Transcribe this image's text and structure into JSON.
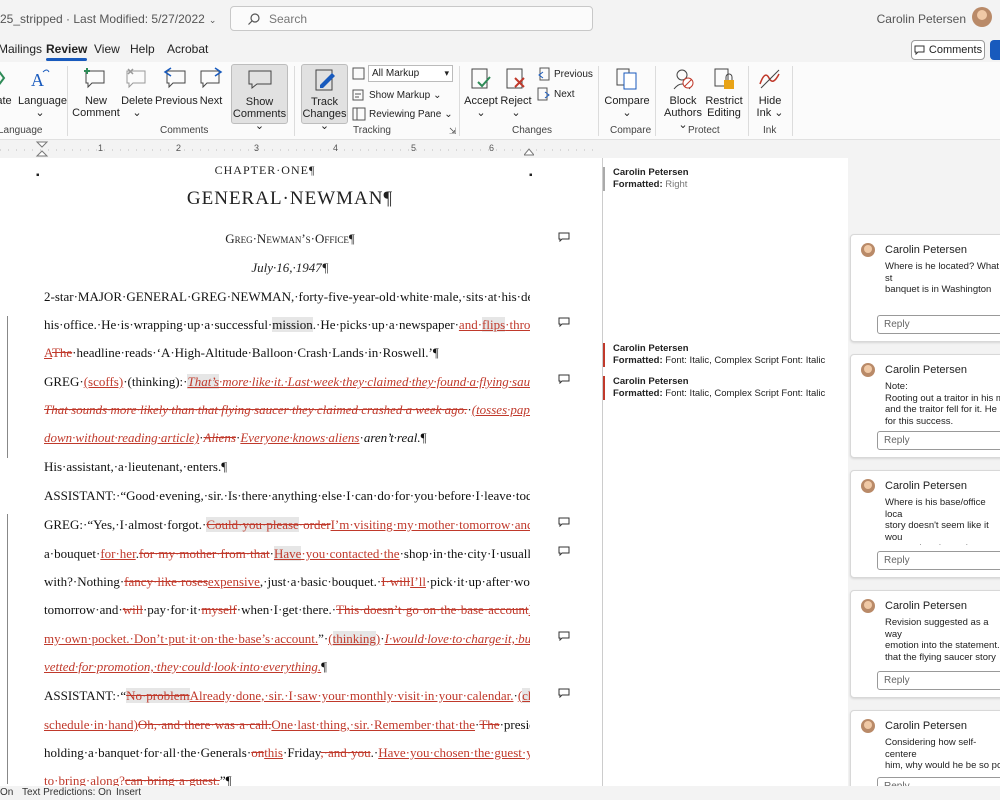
{
  "title": {
    "text": "25_stripped  ·  Last Modified: 5/27/2022"
  },
  "search": {
    "placeholder": "Search"
  },
  "user": {
    "name": "Carolin Petersen"
  },
  "menu": {
    "items": [
      "Mailings",
      "Review",
      "View",
      "Help",
      "Acrobat"
    ],
    "active": "Review",
    "comments_label": "Comments"
  },
  "ribbon": {
    "translate_label": "ate",
    "language_label": "Language",
    "language_group": "Language",
    "new_comment": [
      "New",
      "Comment"
    ],
    "delete": "Delete",
    "previous": "Previous",
    "next": "Next",
    "show_comments": [
      "Show",
      "Comments"
    ],
    "comments_group": "Comments",
    "track_changes": [
      "Track",
      "Changes"
    ],
    "markup_dropdown": "All Markup",
    "show_markup": "Show Markup",
    "reviewing_pane": "Reviewing Pane",
    "tracking_group": "Tracking",
    "accept": "Accept",
    "reject": "Reject",
    "changes_previous": "Previous",
    "changes_next": "Next",
    "changes_group": "Changes",
    "compare": "Compare",
    "compare_group": "Compare",
    "block_authors": [
      "Block",
      "Authors"
    ],
    "restrict_editing": [
      "Restrict",
      "Editing"
    ],
    "protect_group": "Protect",
    "hide_ink": [
      "Hide",
      "Ink"
    ],
    "ink_group": "Ink"
  },
  "ruler": {
    "numbers": [
      "1",
      "2",
      "3",
      "4",
      "5",
      "6"
    ]
  },
  "document": {
    "chapter": "CHAPTER·ONE¶",
    "title": "GENERAL·NEWMAN¶",
    "office": "Greg·Newman’s·Office¶",
    "date": "July·16,·1947¶"
  },
  "markup": [
    {
      "author": "Carolin Petersen",
      "label": "Formatted:",
      "detail": "Right"
    },
    {
      "author": "Carolin Petersen",
      "label": "Formatted:",
      "detail": "Font: Italic, Complex Script Font: Italic"
    },
    {
      "author": "Carolin Petersen",
      "label": "Formatted:",
      "detail": "Font: Italic, Complex Script Font: Italic"
    }
  ],
  "comments": [
    {
      "author": "Carolin Petersen",
      "text": "Where is he located? What st\nbanquet is in Washington DC\nto there?",
      "reply": "Reply"
    },
    {
      "author": "Carolin Petersen",
      "text": "Note:\nRooting out a traitor in his m\nand the traitor fell for it. He c\nfor this success.",
      "reply": "Reply"
    },
    {
      "author": "Carolin Petersen",
      "text": "Where is his base/office loca\nstory doesn't seem like it wou\npage unless it was in Roswell\nsure if the alien vessel was o",
      "reply": "Reply"
    },
    {
      "author": "Carolin Petersen",
      "text": "Revision suggested as a way\nemotion into the statement.\nthat the flying saucer story w\nreferences the flying saucer a",
      "reply": "Reply"
    },
    {
      "author": "Carolin Petersen",
      "text": "Considering how self-centere\nhim, why would he be so pol\nofficer?",
      "reply": "Reply"
    }
  ],
  "status": {
    "page": "On",
    "predictions": "Text Predictions: On",
    "mode": "Insert"
  }
}
